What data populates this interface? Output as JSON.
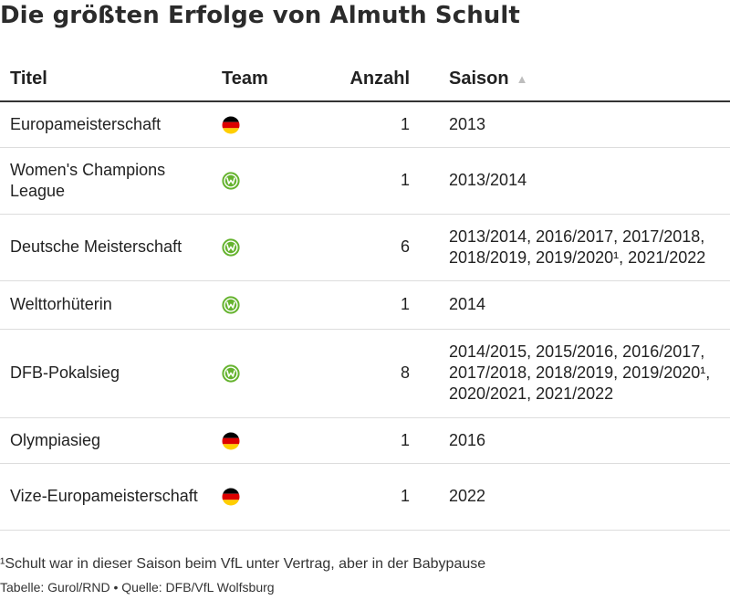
{
  "title": "Die größten Erfolge von Almuth Schult",
  "chart_data": {
    "type": "table",
    "columns": [
      {
        "label": "Titel"
      },
      {
        "label": "Team"
      },
      {
        "label": "Anzahl"
      },
      {
        "label": "Saison",
        "sort": "ascending"
      }
    ],
    "rows": [
      {
        "titel": "Europameisterschaft",
        "team": "germany-flag-icon",
        "anzahl": "1",
        "saison": "2013",
        "height": 50
      },
      {
        "titel": "Women's Champions League",
        "team": "vfl-wolfsburg-logo-icon",
        "anzahl": "1",
        "saison": "2013/2014",
        "height": 73
      },
      {
        "titel": "Deutsche Meisterschaft",
        "team": "vfl-wolfsburg-logo-icon",
        "anzahl": "6",
        "saison": "2013/2014, 2016/2017, 2017/2018, 2018/2019, 2019/2020¹, 2021/2022",
        "height": 73
      },
      {
        "titel": "Welttorhüterin",
        "team": "vfl-wolfsburg-logo-icon",
        "anzahl": "1",
        "saison": "2014",
        "height": 53
      },
      {
        "titel": "DFB-Pokalsieg",
        "team": "vfl-wolfsburg-logo-icon",
        "anzahl": "8",
        "saison": "2014/2015, 2015/2016, 2016/2017, 2017/2018, 2018/2019, 2019/2020¹, 2020/2021, 2021/2022",
        "height": 97
      },
      {
        "titel": "Olympiasieg",
        "team": "germany-flag-icon",
        "anzahl": "1",
        "saison": "2016",
        "height": 50
      },
      {
        "titel": "Vize-Europameisterschaft",
        "team": "germany-flag-icon",
        "anzahl": "1",
        "saison": "2022",
        "height": 73
      }
    ]
  },
  "footnote": "¹Schult war in dieser Saison beim VfL unter Vertrag, aber in der Babypause",
  "source": "Tabelle: Gurol/RND • Quelle: DFB/VfL Wolfsburg",
  "colors": {
    "wolfsburg_green": "#65B32E",
    "flag_black": "#000000",
    "flag_red": "#DD0000",
    "flag_gold": "#FFCE00",
    "sort_arrow": "#BDBDBD"
  }
}
